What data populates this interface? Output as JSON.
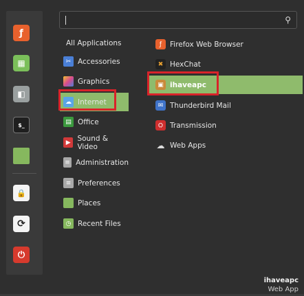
{
  "search": {
    "placeholder": "",
    "value": ""
  },
  "favorites": [
    {
      "icon": "firefox-icon",
      "glyph": "ƒ",
      "color": "#e8612d"
    },
    {
      "icon": "grid-apps-icon",
      "glyph": "▦",
      "color": "#7bbf5a"
    },
    {
      "icon": "toggle-settings-icon",
      "glyph": "◧",
      "color": "#9aa0a0"
    },
    {
      "icon": "terminal-icon",
      "glyph": "$_",
      "color": "#1f1f1f"
    },
    {
      "icon": "folder-icon",
      "glyph": "",
      "color": "#86b85e"
    },
    {
      "icon": "lock-icon",
      "glyph": "🔒",
      "color": "#2a2a2a"
    },
    {
      "icon": "logout-icon",
      "glyph": "⟳",
      "color": "#2a2a2a"
    },
    {
      "icon": "power-icon",
      "glyph": "⏻",
      "color": "#d63a2d"
    }
  ],
  "categories": [
    {
      "label": "All Applications",
      "icon": "",
      "glyph": "",
      "color": ""
    },
    {
      "label": "Accessories",
      "icon": "accessories-icon",
      "glyph": "✂",
      "color": "#4a7fd6"
    },
    {
      "label": "Graphics",
      "icon": "graphics-icon",
      "glyph": "◆",
      "color": "#c04cc9"
    },
    {
      "label": "Internet",
      "icon": "cloud-icon",
      "glyph": "☁",
      "color": "#5aa5e6"
    },
    {
      "label": "Office",
      "icon": "office-icon",
      "glyph": "▤",
      "color": "#3b9a3e"
    },
    {
      "label": "Sound & Video",
      "icon": "play-icon",
      "glyph": "▶",
      "color": "#d23a3a"
    },
    {
      "label": "Administration",
      "icon": "admin-icon",
      "glyph": "≡",
      "color": "#a9a9a9"
    },
    {
      "label": "Preferences",
      "icon": "preferences-icon",
      "glyph": "≡",
      "color": "#a9a9a9"
    },
    {
      "label": "Places",
      "icon": "places-folder-icon",
      "glyph": "",
      "color": "#86b85e"
    },
    {
      "label": "Recent Files",
      "icon": "recent-folder-icon",
      "glyph": "◷",
      "color": "#86b85e"
    }
  ],
  "apps": [
    {
      "label": "Firefox Web Browser",
      "icon": "firefox-icon",
      "glyph": "ƒ",
      "color": "#e8612d"
    },
    {
      "label": "HexChat",
      "icon": "hexchat-icon",
      "glyph": "✖",
      "color": "#222222"
    },
    {
      "label": "ihaveapc",
      "icon": "ihaveapc-icon",
      "glyph": "▣",
      "color": "#c98a3a"
    },
    {
      "label": "Thunderbird Mail",
      "icon": "thunderbird-icon",
      "glyph": "✉",
      "color": "#3f73c9"
    },
    {
      "label": "Transmission",
      "icon": "transmission-icon",
      "glyph": "⛭",
      "color": "#cf2e2e"
    },
    {
      "label": "Web Apps",
      "icon": "webapps-icon",
      "glyph": "☁",
      "color": "#3a3a3a"
    }
  ],
  "selected_category": "Internet",
  "selected_app": "ihaveapc",
  "description": {
    "name": "ihaveapc",
    "detail": "Web App"
  },
  "colors": {
    "accent": "#8fbb6c",
    "highlight": "#d9232a",
    "background": "#2f2f2f"
  }
}
